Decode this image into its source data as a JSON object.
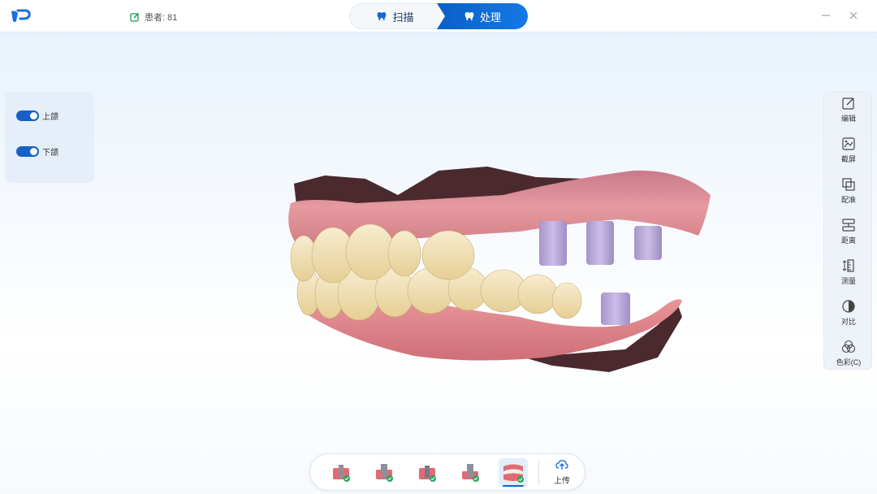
{
  "header": {
    "patient_label": "患者: 81",
    "tabs": {
      "scan": "扫描",
      "process": "处理"
    },
    "active_tab": "process"
  },
  "jaws": [
    {
      "label": "上颌",
      "enabled": true
    },
    {
      "label": "下颌",
      "enabled": true
    }
  ],
  "tools": [
    {
      "label": "编辑",
      "icon": "edit-icon"
    },
    {
      "label": "截屏",
      "icon": "screenshot-icon"
    },
    {
      "label": "配准",
      "icon": "registration-icon"
    },
    {
      "label": "距离",
      "icon": "distance-icon"
    },
    {
      "label": "测量",
      "icon": "measure-icon"
    },
    {
      "label": "对比",
      "icon": "compare-icon"
    },
    {
      "label": "色彩(C)",
      "icon": "color-icon"
    }
  ],
  "steps": {
    "items": [
      "implant-scanbody-1",
      "implant-scanbody-2",
      "implant-scanbody-3",
      "implant-scanbody-4",
      "full-arch"
    ],
    "active_index": 4,
    "upload_label": "上传"
  },
  "colors": {
    "accent": "#1468d6",
    "gum": "#e08a8a",
    "tooth": "#f2e2b8",
    "scan_body": "#b7a6d6"
  }
}
